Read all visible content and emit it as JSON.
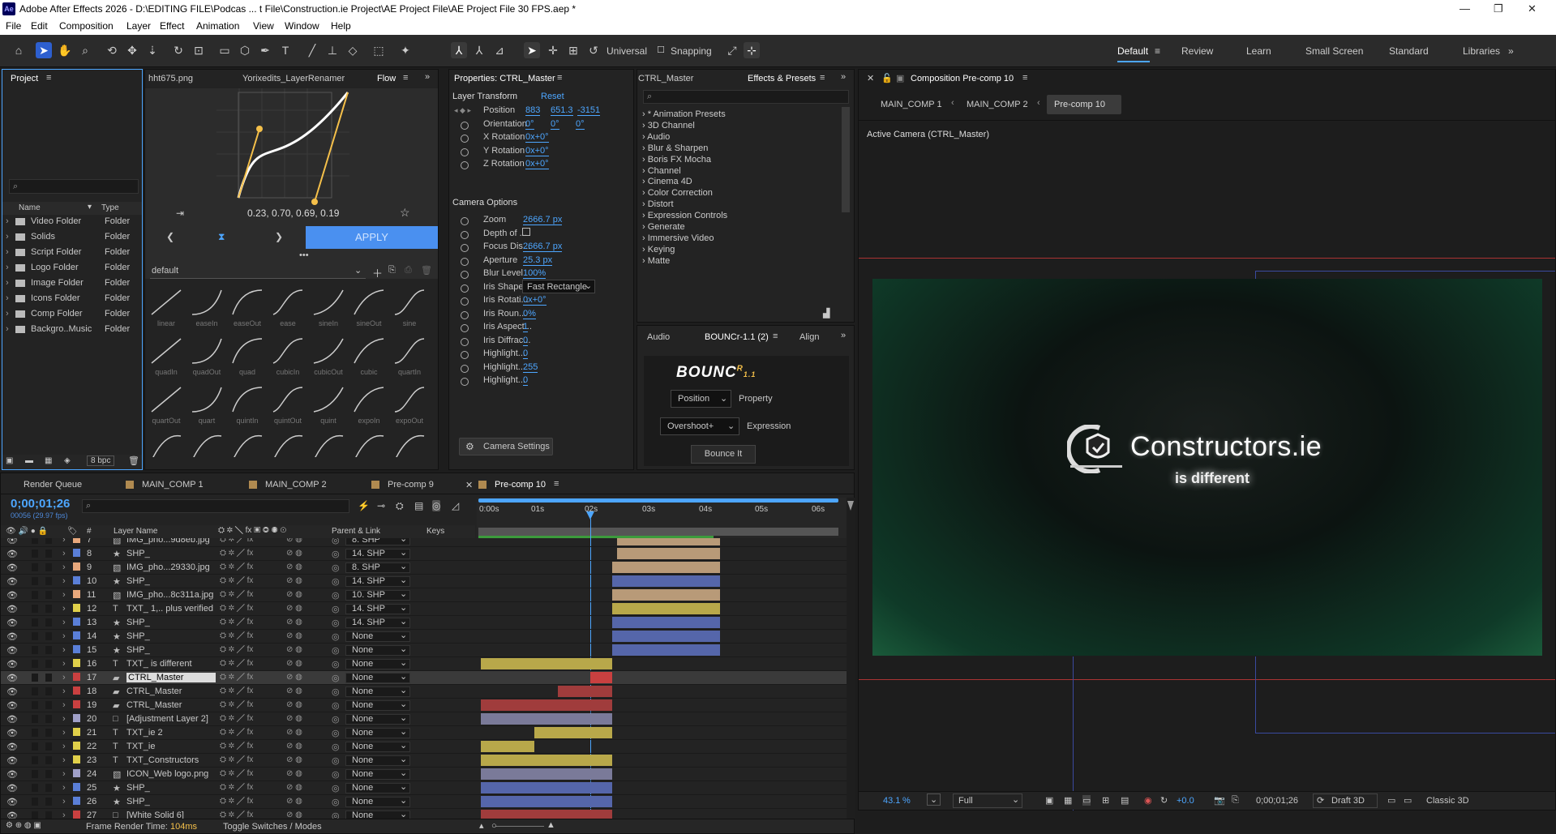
{
  "app": {
    "title": "Adobe After Effects 2026 - D:\\EDITING FILE\\Podcas ... t File\\Construction.ie Project\\AE Project File\\AE Project File 30 FPS.aep *",
    "logo": "Ae"
  },
  "menu": [
    "File",
    "Edit",
    "Composition",
    "Layer",
    "Effect",
    "Animation",
    "View",
    "Window",
    "Help"
  ],
  "toolbar": {
    "universal": "Universal",
    "snapping": "Snapping"
  },
  "workspaces": [
    "Default",
    "Review",
    "Learn",
    "Small Screen",
    "Standard",
    "Libraries"
  ],
  "project": {
    "tab": "Project",
    "col_name": "Name",
    "col_type": "Type",
    "bpc": "8 bpc",
    "items": [
      {
        "name": "Video Folder",
        "type": "Folder"
      },
      {
        "name": "Solids",
        "type": "Folder"
      },
      {
        "name": "Script Folder",
        "type": "Folder"
      },
      {
        "name": "Logo Folder",
        "type": "Folder"
      },
      {
        "name": "Image Folder",
        "type": "Folder"
      },
      {
        "name": "Icons Folder",
        "type": "Folder"
      },
      {
        "name": "Comp Folder",
        "type": "Folder"
      },
      {
        "name": "Backgro..Music",
        "type": "Folder"
      }
    ]
  },
  "flow": {
    "tab1": "hht675.png",
    "tab2": "Yorixedits_LayerRenamer",
    "tab3": "Flow",
    "values": "0.23, 0.70, 0.69, 0.19",
    "apply": "APPLY",
    "preset": "default",
    "eases": [
      "linear",
      "easeIn",
      "easeOut",
      "ease",
      "sineIn",
      "sineOut",
      "sine",
      "quadIn",
      "quadOut",
      "quad",
      "cubicIn",
      "cubicOut",
      "cubic",
      "quartIn",
      "quartOut",
      "quart",
      "quintIn",
      "quintOut",
      "quint",
      "expoIn",
      "expoOut"
    ]
  },
  "properties": {
    "tab": "Properties: CTRL_Master",
    "layer_transform": "Layer Transform",
    "reset": "Reset",
    "transform": [
      {
        "name": "Position",
        "vals": [
          "883",
          "651.3",
          "-3151"
        ]
      },
      {
        "name": "Orientation",
        "vals": [
          "0°",
          "0°",
          "0°"
        ]
      },
      {
        "name": "X Rotation",
        "vals": [
          "0x+0°"
        ]
      },
      {
        "name": "Y Rotation",
        "vals": [
          "0x+0°"
        ]
      },
      {
        "name": "Z Rotation",
        "vals": [
          "0x+0°"
        ]
      }
    ],
    "camera_options": "Camera Options",
    "camera": [
      {
        "name": "Zoom",
        "val": "2666.7 px"
      },
      {
        "name": "Depth of ...",
        "val": ""
      },
      {
        "name": "Focus Dis...",
        "val": "2666.7 px"
      },
      {
        "name": "Aperture",
        "val": "25.3 px"
      },
      {
        "name": "Blur Level",
        "val": "100%"
      },
      {
        "name": "Iris Shape",
        "val": "Fast Rectangle"
      },
      {
        "name": "Iris Rotati...",
        "val": "0x+0°"
      },
      {
        "name": "Iris Roun...",
        "val": "0%"
      },
      {
        "name": "Iris Aspect...",
        "val": "1"
      },
      {
        "name": "Iris Diffrac...",
        "val": "0"
      },
      {
        "name": "Highlight...",
        "val": "0"
      },
      {
        "name": "Highlight...",
        "val": "255"
      },
      {
        "name": "Highlight...",
        "val": "0"
      }
    ],
    "camera_settings": "Camera Settings"
  },
  "effects": {
    "tab1": "CTRL_Master",
    "tab2": "Effects & Presets",
    "items": [
      "* Animation Presets",
      "3D Channel",
      "Audio",
      "Blur & Sharpen",
      "Boris FX Mocha",
      "Channel",
      "Cinema 4D",
      "Color Correction",
      "Distort",
      "Expression Controls",
      "Generate",
      "Immersive Video",
      "Keying",
      "Matte"
    ]
  },
  "bouncr": {
    "tab1": "Audio",
    "tab2": "BOUNCr-1.1 (2)",
    "tab3": "Align",
    "logo": "BOUNC",
    "logo_sup": "R",
    "logo_ver": "1.1",
    "position": "Position",
    "property": "Property",
    "overshoot": "Overshoot+",
    "expression": "Expression",
    "bounce": "Bounce It"
  },
  "viewer": {
    "tab": "Composition Pre-comp 10",
    "crumbs": [
      "MAIN_COMP 1",
      "MAIN_COMP 2",
      "Pre-comp 10"
    ],
    "camera": "Active Camera (CTRL_Master)",
    "brand": "Constructors.ie",
    "tagline": "is different",
    "zoom": "43.1",
    "zoom_unit": "%",
    "resolution": "Full",
    "exposure": "+0.0",
    "timecode": "0;00;01;26",
    "renderer": "Draft 3D",
    "mode": "Classic 3D"
  },
  "timeline": {
    "tabs": [
      "Render Queue",
      "MAIN_COMP 1",
      "MAIN_COMP 2",
      "Pre-comp 9",
      "Pre-comp 10"
    ],
    "timecode": "0;00;01;26",
    "frames": "00056 (29.97 fps)",
    "col_layer": "Layer Name",
    "col_parent": "Parent & Link",
    "col_keys": "Keys",
    "ruler": [
      "0:00s",
      "01s",
      "02s",
      "03s",
      "04s",
      "05s",
      "06s"
    ],
    "frame_render_label": "Frame Render Time:",
    "frame_render_value": "104ms",
    "toggle": "Toggle Switches / Modes",
    "layers": [
      {
        "num": "7",
        "name": "IMG_pho...9d8eb.jpg",
        "parent": "8. SHP",
        "icon": "img",
        "color": "#e8a87c"
      },
      {
        "num": "8",
        "name": "SHP_",
        "parent": "14. SHP",
        "icon": "star",
        "color": "#5a7fd8"
      },
      {
        "num": "9",
        "name": "IMG_pho...29330.jpg",
        "parent": "8. SHP",
        "icon": "img",
        "color": "#e8a87c"
      },
      {
        "num": "10",
        "name": "SHP_",
        "parent": "14. SHP",
        "icon": "star",
        "color": "#5a7fd8"
      },
      {
        "num": "11",
        "name": "IMG_pho...8c311a.jpg",
        "parent": "10. SHP",
        "icon": "img",
        "color": "#e8a87c"
      },
      {
        "num": "12",
        "name": "TXT_ 1,.. plus verified",
        "parent": "14. SHP",
        "icon": "T",
        "color": "#e0d04a"
      },
      {
        "num": "13",
        "name": "SHP_",
        "parent": "14. SHP",
        "icon": "star",
        "color": "#5a7fd8"
      },
      {
        "num": "14",
        "name": "SHP_",
        "parent": "None",
        "icon": "star",
        "color": "#5a7fd8"
      },
      {
        "num": "15",
        "name": "SHP_",
        "parent": "None",
        "icon": "star",
        "color": "#5a7fd8"
      },
      {
        "num": "16",
        "name": "TXT_ is different",
        "parent": "None",
        "icon": "T",
        "color": "#e0d04a"
      },
      {
        "num": "17",
        "name": "CTRL_Master",
        "parent": "None",
        "icon": "cam",
        "color": "#c94040"
      },
      {
        "num": "18",
        "name": "CTRL_Master",
        "parent": "None",
        "icon": "cam",
        "color": "#c94040"
      },
      {
        "num": "19",
        "name": "CTRL_Master",
        "parent": "None",
        "icon": "cam",
        "color": "#c94040"
      },
      {
        "num": "20",
        "name": "[Adjustment Layer 2]",
        "parent": "None",
        "icon": "sq",
        "color": "#a0a0c8"
      },
      {
        "num": "21",
        "name": "TXT_ie 2",
        "parent": "None",
        "icon": "T",
        "color": "#e0d04a"
      },
      {
        "num": "22",
        "name": "TXT_ie",
        "parent": "None",
        "icon": "T",
        "color": "#e0d04a"
      },
      {
        "num": "23",
        "name": "TXT_Constructors",
        "parent": "None",
        "icon": "T",
        "color": "#e0d04a"
      },
      {
        "num": "24",
        "name": "ICON_Web logo.png",
        "parent": "None",
        "icon": "img",
        "color": "#a0a0c8"
      },
      {
        "num": "25",
        "name": "SHP_",
        "parent": "None",
        "icon": "star",
        "color": "#5a7fd8"
      },
      {
        "num": "26",
        "name": "SHP_",
        "parent": "None",
        "icon": "star",
        "color": "#5a7fd8"
      },
      {
        "num": "27",
        "name": "[White Solid 6]",
        "parent": "None",
        "icon": "sq",
        "color": "#c94040"
      }
    ]
  },
  "colors": {
    "accent": "#2d5fcf",
    "link": "#4da6ff",
    "playhead": "#4da6ff",
    "bezier": "#f5c04a"
  }
}
